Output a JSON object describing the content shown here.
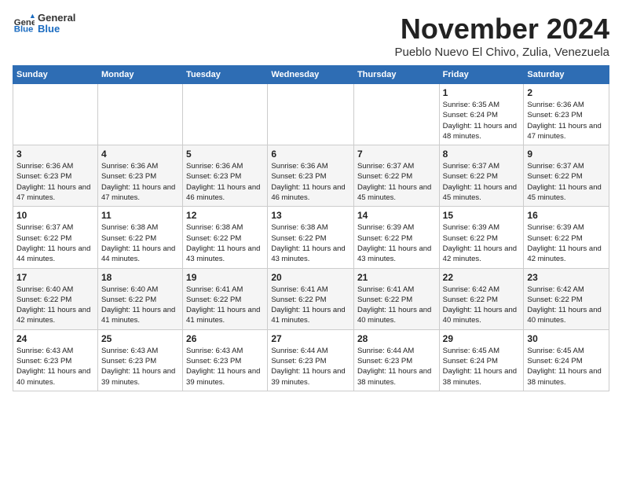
{
  "header": {
    "logo_general": "General",
    "logo_blue": "Blue",
    "month_title": "November 2024",
    "location": "Pueblo Nuevo El Chivo, Zulia, Venezuela"
  },
  "days_of_week": [
    "Sunday",
    "Monday",
    "Tuesday",
    "Wednesday",
    "Thursday",
    "Friday",
    "Saturday"
  ],
  "weeks": [
    [
      {
        "num": "",
        "info": ""
      },
      {
        "num": "",
        "info": ""
      },
      {
        "num": "",
        "info": ""
      },
      {
        "num": "",
        "info": ""
      },
      {
        "num": "",
        "info": ""
      },
      {
        "num": "1",
        "info": "Sunrise: 6:35 AM\nSunset: 6:24 PM\nDaylight: 11 hours and 48 minutes."
      },
      {
        "num": "2",
        "info": "Sunrise: 6:36 AM\nSunset: 6:23 PM\nDaylight: 11 hours and 47 minutes."
      }
    ],
    [
      {
        "num": "3",
        "info": "Sunrise: 6:36 AM\nSunset: 6:23 PM\nDaylight: 11 hours and 47 minutes."
      },
      {
        "num": "4",
        "info": "Sunrise: 6:36 AM\nSunset: 6:23 PM\nDaylight: 11 hours and 47 minutes."
      },
      {
        "num": "5",
        "info": "Sunrise: 6:36 AM\nSunset: 6:23 PM\nDaylight: 11 hours and 46 minutes."
      },
      {
        "num": "6",
        "info": "Sunrise: 6:36 AM\nSunset: 6:23 PM\nDaylight: 11 hours and 46 minutes."
      },
      {
        "num": "7",
        "info": "Sunrise: 6:37 AM\nSunset: 6:22 PM\nDaylight: 11 hours and 45 minutes."
      },
      {
        "num": "8",
        "info": "Sunrise: 6:37 AM\nSunset: 6:22 PM\nDaylight: 11 hours and 45 minutes."
      },
      {
        "num": "9",
        "info": "Sunrise: 6:37 AM\nSunset: 6:22 PM\nDaylight: 11 hours and 45 minutes."
      }
    ],
    [
      {
        "num": "10",
        "info": "Sunrise: 6:37 AM\nSunset: 6:22 PM\nDaylight: 11 hours and 44 minutes."
      },
      {
        "num": "11",
        "info": "Sunrise: 6:38 AM\nSunset: 6:22 PM\nDaylight: 11 hours and 44 minutes."
      },
      {
        "num": "12",
        "info": "Sunrise: 6:38 AM\nSunset: 6:22 PM\nDaylight: 11 hours and 43 minutes."
      },
      {
        "num": "13",
        "info": "Sunrise: 6:38 AM\nSunset: 6:22 PM\nDaylight: 11 hours and 43 minutes."
      },
      {
        "num": "14",
        "info": "Sunrise: 6:39 AM\nSunset: 6:22 PM\nDaylight: 11 hours and 43 minutes."
      },
      {
        "num": "15",
        "info": "Sunrise: 6:39 AM\nSunset: 6:22 PM\nDaylight: 11 hours and 42 minutes."
      },
      {
        "num": "16",
        "info": "Sunrise: 6:39 AM\nSunset: 6:22 PM\nDaylight: 11 hours and 42 minutes."
      }
    ],
    [
      {
        "num": "17",
        "info": "Sunrise: 6:40 AM\nSunset: 6:22 PM\nDaylight: 11 hours and 42 minutes."
      },
      {
        "num": "18",
        "info": "Sunrise: 6:40 AM\nSunset: 6:22 PM\nDaylight: 11 hours and 41 minutes."
      },
      {
        "num": "19",
        "info": "Sunrise: 6:41 AM\nSunset: 6:22 PM\nDaylight: 11 hours and 41 minutes."
      },
      {
        "num": "20",
        "info": "Sunrise: 6:41 AM\nSunset: 6:22 PM\nDaylight: 11 hours and 41 minutes."
      },
      {
        "num": "21",
        "info": "Sunrise: 6:41 AM\nSunset: 6:22 PM\nDaylight: 11 hours and 40 minutes."
      },
      {
        "num": "22",
        "info": "Sunrise: 6:42 AM\nSunset: 6:22 PM\nDaylight: 11 hours and 40 minutes."
      },
      {
        "num": "23",
        "info": "Sunrise: 6:42 AM\nSunset: 6:22 PM\nDaylight: 11 hours and 40 minutes."
      }
    ],
    [
      {
        "num": "24",
        "info": "Sunrise: 6:43 AM\nSunset: 6:23 PM\nDaylight: 11 hours and 40 minutes."
      },
      {
        "num": "25",
        "info": "Sunrise: 6:43 AM\nSunset: 6:23 PM\nDaylight: 11 hours and 39 minutes."
      },
      {
        "num": "26",
        "info": "Sunrise: 6:43 AM\nSunset: 6:23 PM\nDaylight: 11 hours and 39 minutes."
      },
      {
        "num": "27",
        "info": "Sunrise: 6:44 AM\nSunset: 6:23 PM\nDaylight: 11 hours and 39 minutes."
      },
      {
        "num": "28",
        "info": "Sunrise: 6:44 AM\nSunset: 6:23 PM\nDaylight: 11 hours and 38 minutes."
      },
      {
        "num": "29",
        "info": "Sunrise: 6:45 AM\nSunset: 6:24 PM\nDaylight: 11 hours and 38 minutes."
      },
      {
        "num": "30",
        "info": "Sunrise: 6:45 AM\nSunset: 6:24 PM\nDaylight: 11 hours and 38 minutes."
      }
    ]
  ]
}
